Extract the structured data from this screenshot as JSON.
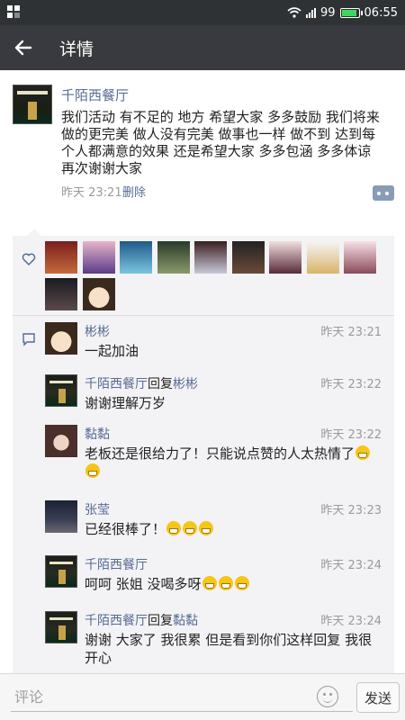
{
  "status_bar": {
    "signal_label": "99",
    "battery_level": 0.95,
    "time": "06:55",
    "battery_color": "#3fd65b"
  },
  "header": {
    "back_icon": "arrow-left-icon",
    "title": "详情"
  },
  "post": {
    "author": "千陌西餐厅",
    "text": "我们活动 有不足的 地方 希望大家 多多鼓励 我们将来做的更完美 做人没有完美 做事也一样 做不到 达到每个人都满意的效果 还是希望大家 多多包涵 多多体谅 再次谢谢大家",
    "time": "昨天 23:21",
    "delete_label": "删除"
  },
  "likes": {
    "icon": "heart-icon",
    "count": 11
  },
  "comments": [
    {
      "name": "彬彬",
      "reply_word": "",
      "reply_to": "",
      "time": "昨天 23:21",
      "text": "一起加油",
      "emoji_count": 0,
      "avatar": "cartoon"
    },
    {
      "name": "千陌西餐厅",
      "reply_word": "回复",
      "reply_to": "彬彬",
      "time": "昨天 23:22",
      "text": "谢谢理解万岁",
      "emoji_count": 0,
      "avatar": "store"
    },
    {
      "name": "黏黏",
      "reply_word": "",
      "reply_to": "",
      "time": "昨天 23:22",
      "text": "老板还是很给力了！只能说点赞的人太热情了",
      "emoji_count": 2,
      "avatar": "girl"
    },
    {
      "name": "张莹",
      "reply_word": "",
      "reply_to": "",
      "time": "昨天 23:23",
      "text": "已经很棒了！",
      "emoji_count": 3,
      "avatar": "night"
    },
    {
      "name": "千陌西餐厅",
      "reply_word": "",
      "reply_to": "",
      "time": "昨天 23:24",
      "text": "呵呵 张姐 没喝多呀",
      "emoji_count": 3,
      "avatar": "store"
    },
    {
      "name": "千陌西餐厅",
      "reply_word": "回复",
      "reply_to": "黏黏",
      "time": "昨天 23:24",
      "text": "谢谢 大家了 我很累 但是看到你们这样回复 我很开心",
      "emoji_count": 0,
      "avatar": "store"
    }
  ],
  "input_bar": {
    "placeholder": "评论",
    "send_label": "发送"
  }
}
